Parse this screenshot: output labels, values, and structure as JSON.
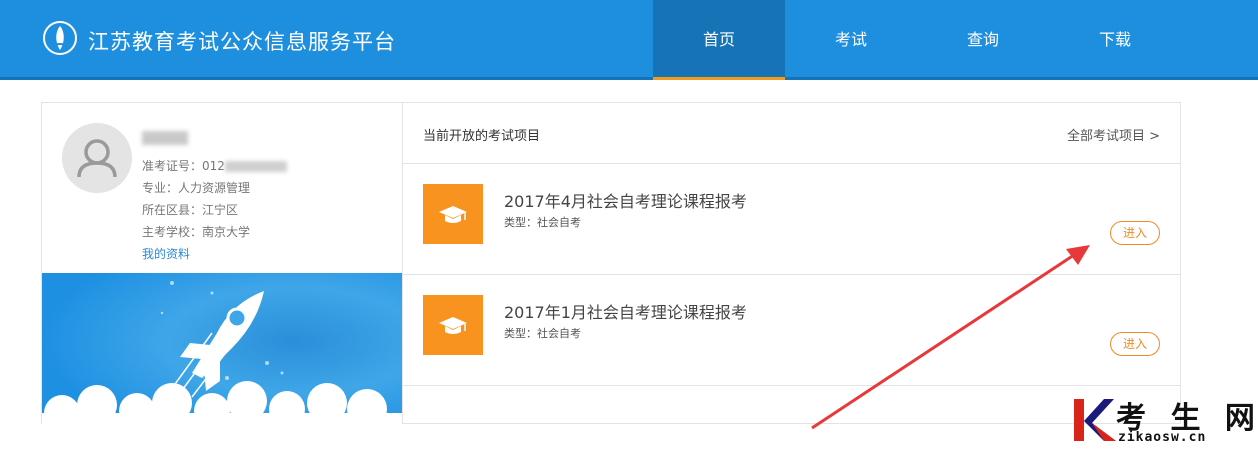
{
  "header": {
    "site_title": "江苏教育考试公众信息服务平台",
    "nav": [
      {
        "label": "首页",
        "active": true
      },
      {
        "label": "考试",
        "active": false
      },
      {
        "label": "查询",
        "active": false
      },
      {
        "label": "下载",
        "active": false
      }
    ]
  },
  "user": {
    "ticket_label": "准考证号：012",
    "major": "专业：人力资源管理",
    "district": "所在区县：江宁区",
    "school": "主考学校：南京大学",
    "profile_link": "我的资料"
  },
  "exams": {
    "section_title": "当前开放的考试项目",
    "all_link": "全部考试项目 >",
    "items": [
      {
        "title": "2017年4月社会自考理论课程报考",
        "type": "类型：社会自考",
        "button": "进入"
      },
      {
        "title": "2017年1月社会自考理论课程报考",
        "type": "类型：社会自考",
        "button": "进入"
      }
    ]
  },
  "watermark": {
    "text": "考 生 网",
    "sub": "zikaosw.cn"
  },
  "colors": {
    "header": "#1e8fde",
    "nav_active": "#1673b6",
    "accent_orange": "#f7931e",
    "link_blue": "#2a8bd6",
    "arrow_red": "#e8393a"
  }
}
